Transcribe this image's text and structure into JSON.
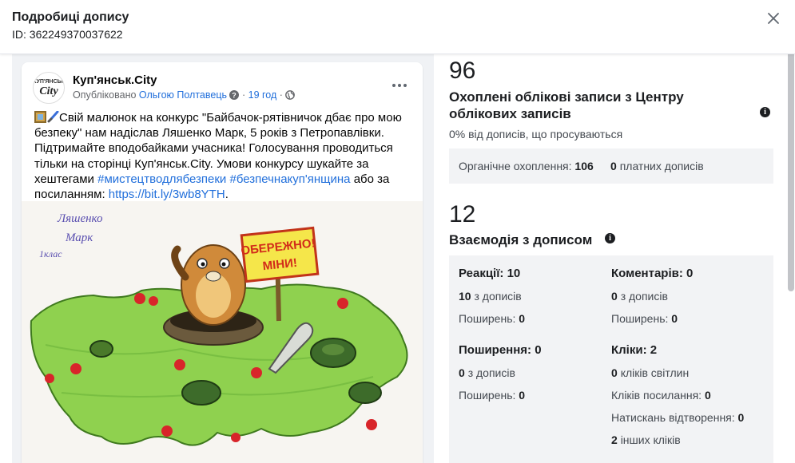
{
  "header": {
    "title": "Подробиці допису",
    "id_label": "ID: 362249370037622"
  },
  "post": {
    "avatar_top": "КУП'ЯНСЬК",
    "avatar_bottom": "City",
    "page_name": "Куп'янськ.City",
    "published_prefix": "Опубліковано",
    "author": "Ольгою Полтавець",
    "time": "19 год",
    "text_1": "Свій малюнок на конкурс \"Байбачок-рятівничок дбає про мою безпеку\" нам надіслав Ляшенко Марк, 5 років з Петропавлівки. Підтримайте вподобайками учасника! Голосування проводиться тільки на сторінці Куп'янськ.City. Умови конкурсу шукайте за хештегами",
    "hashtag_1": "#мистецтводлябезпеки",
    "hashtag_2": "#безпечнакуп'янщина",
    "text_2": "або за посиланням:",
    "url": "https://bit.ly/3wb8YTH",
    "image": {
      "sign_line1": "ОБЕРЕЖНО!",
      "sign_line2": "МІНИ!",
      "handwriting_1": "Ляшенко",
      "handwriting_2": "Марк",
      "handwriting_3": "1клас"
    }
  },
  "reach": {
    "value": "96",
    "title": "Охоплені облікові записи з Центру облікових записів",
    "subtitle": "0% від дописів, що просуваються",
    "organic_label": "Органічне охоплення:",
    "organic_value": "106",
    "paid_value": "0",
    "paid_label": "платних дописів"
  },
  "engagement": {
    "value": "12",
    "title": "Взаємодія з дописом",
    "reactions": {
      "head": "Реакції: 10",
      "from_posts_value": "10",
      "from_posts_label": "з дописів",
      "shares_label": "Поширень:",
      "shares_value": "0"
    },
    "comments": {
      "head": "Коментарів: 0",
      "from_posts_value": "0",
      "from_posts_label": "з дописів",
      "shares_label": "Поширень:",
      "shares_value": "0"
    },
    "shares": {
      "head": "Поширення: 0",
      "from_posts_value": "0",
      "from_posts_label": "з дописів",
      "shares_label": "Поширень:",
      "shares_value": "0"
    },
    "clicks": {
      "head": "Кліки: 2",
      "photo_value": "0",
      "photo_label": "кліків світлин",
      "link_label": "Кліків посилання:",
      "link_value": "0",
      "play_label": "Натискань відтворення:",
      "play_value": "0",
      "other_value": "2",
      "other_label": "інших кліків"
    }
  }
}
